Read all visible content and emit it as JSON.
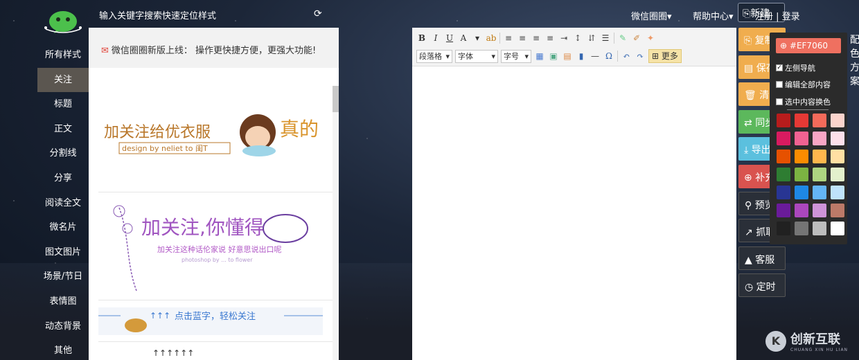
{
  "topbar": {
    "search_hint": "输入关键字搜索快速定位样式",
    "menu_weixin": "微信圈圈▾",
    "menu_help": "帮助中心▾",
    "box_label": "新建",
    "login": "注册 | 登录"
  },
  "sidebar": {
    "items": [
      {
        "label": "所有样式"
      },
      {
        "label": "关注"
      },
      {
        "label": "标题"
      },
      {
        "label": "正文"
      },
      {
        "label": "分割线"
      },
      {
        "label": "分享"
      },
      {
        "label": "阅读全文"
      },
      {
        "label": "微名片"
      },
      {
        "label": "图文图片"
      },
      {
        "label": "场景/节日"
      },
      {
        "label": "表情图"
      },
      {
        "label": "动态背景"
      },
      {
        "label": "其他"
      }
    ]
  },
  "panel": {
    "notice": "微信圈圈新版上线： 操作更快捷方便，更强大功能!",
    "card1": {
      "main": "加关注给优衣服",
      "sub": "design by neliet to 闺T",
      "right": "真的"
    },
    "card2": {
      "main": "加关注,你懂得",
      "sub": "加关注这种话伦家说 好意思说出口呢",
      "small": "photoshop by ... to flower"
    },
    "card3": {
      "text": "点击蓝字，轻松关注"
    },
    "card4": {
      "text": "↑↑↑↑↑↑"
    }
  },
  "toolbar": {
    "bold": "B",
    "italic": "I",
    "underline": "U",
    "fontcolor": "A",
    "paragraph": "段落格",
    "font": "字体",
    "fontsize": "字号",
    "more": "更多"
  },
  "actions": [
    {
      "label": "复制",
      "color": "#f0ad4e",
      "icon": "copy-icon"
    },
    {
      "label": "保存",
      "color": "#f0ad4e",
      "icon": "save-icon"
    },
    {
      "label": "清空",
      "color": "#f0ad4e",
      "icon": "trash-icon"
    },
    {
      "label": "同步",
      "color": "#5cb85c",
      "icon": "exchange-icon"
    },
    {
      "label": "导出",
      "color": "#5bc0de",
      "icon": "download-icon"
    },
    {
      "label": "补充",
      "color": "#d9534f",
      "icon": "lifebuoy-icon"
    },
    {
      "label": "预览",
      "color": "#2a2f38",
      "icon": "search-icon"
    },
    {
      "label": "抓取",
      "color": "#2a2f38",
      "icon": "external-link-icon"
    },
    {
      "label": "客服",
      "color": "#2a2f38",
      "icon": "bell-icon"
    },
    {
      "label": "定时",
      "color": "#2a2f38",
      "icon": "clock-icon"
    }
  ],
  "color_popup": {
    "hex": "#EF7060",
    "opt_sidebar": "左侧导航",
    "opt_edit_all": "编辑全部内容",
    "opt_selected": "选中内容换色",
    "swatches": [
      "#b71c1c",
      "#e53935",
      "#f46a5a",
      "#fcd4cc",
      "#d81b60",
      "#f06292",
      "#f8a5c4",
      "#fde0ea",
      "#e65100",
      "#fb8c00",
      "#ffb74d",
      "#ffe0a3",
      "#2e7d32",
      "#7cb342",
      "#aed581",
      "#e3f1cc",
      "#283593",
      "#1e88e5",
      "#64b5f6",
      "#bfe3fb",
      "#6a1b9a",
      "#ab47bc",
      "#ce93d8",
      "#bc7a68",
      "#212121",
      "#757575",
      "#bdbdbd",
      "#ffffff"
    ]
  },
  "right_text": "配色方案",
  "watermark": {
    "mark": "K",
    "text": "创新互联",
    "sub": "CHUANG XIN HU LIAN"
  }
}
